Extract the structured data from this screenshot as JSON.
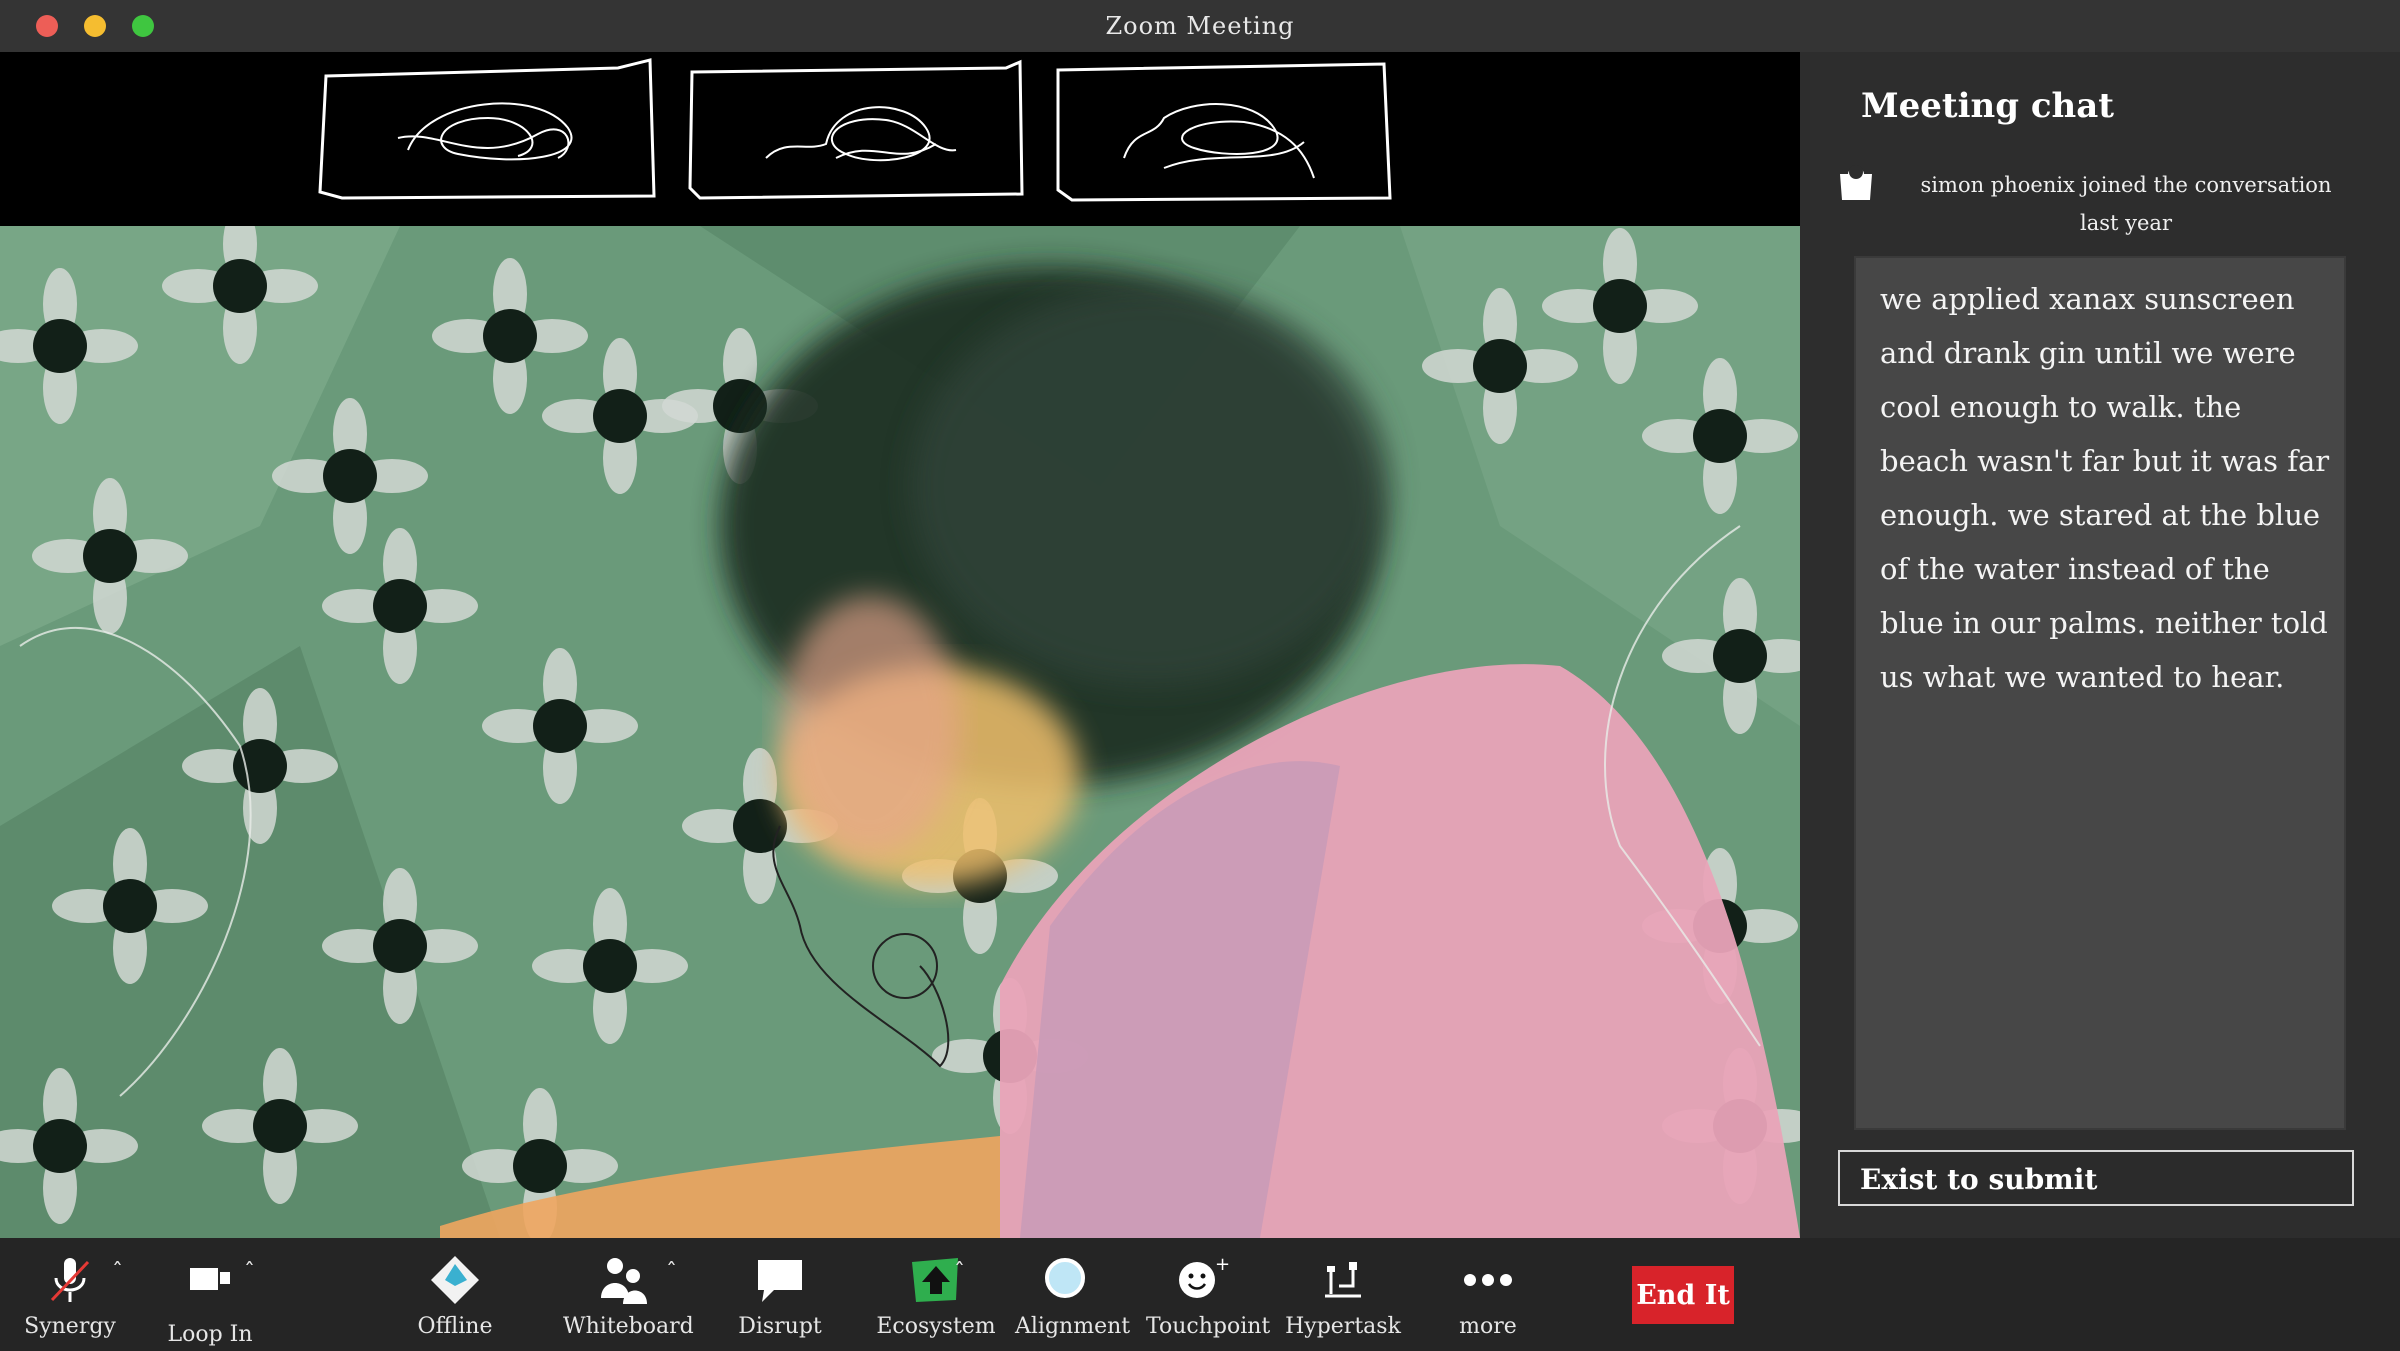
{
  "window": {
    "title": "Zoom Meeting"
  },
  "chat": {
    "title": "Meeting chat",
    "join_line1": "simon phoenix joined the conversation",
    "join_line2": "last year",
    "message": "we applied xanax sunscreen and drank gin until we were cool enough to walk. the beach wasn't far but it was far enough. we stared at the blue of the water instead of the blue in our palms. neither told us what we wanted to hear.",
    "input_placeholder": "Exist to submit"
  },
  "toolbar": {
    "synergy": "Synergy",
    "loop_in": "Loop In",
    "offline": "Offline",
    "whiteboard": "Whiteboard",
    "disrupt": "Disrupt",
    "ecosystem": "Ecosystem",
    "alignment": "Alignment",
    "touchpoint": "Touchpoint",
    "hypertask": "Hypertask",
    "more": "more",
    "end": "End It"
  },
  "colors": {
    "video_bg": "#6a9a7a",
    "pink": "#e9a3b8",
    "end_red": "#d8232a",
    "ecosystem_green": "#2fae4e"
  },
  "icons": [
    "mic-off-icon",
    "video-camera-icon",
    "offline-diamond-icon",
    "people-icon",
    "speech-bubble-icon",
    "upload-arrow-icon",
    "circle-icon",
    "smiley-plus-icon",
    "hypertask-icon",
    "ellipsis-icon"
  ]
}
